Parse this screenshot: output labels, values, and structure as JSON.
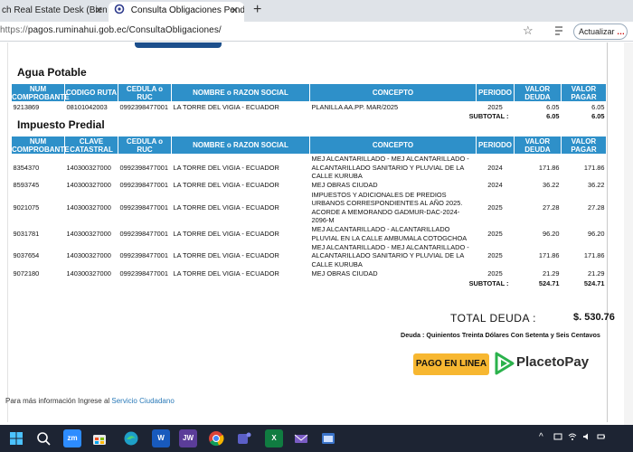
{
  "browser": {
    "tabs": [
      {
        "title": "ch Real Estate Desk (Bienes R"
      },
      {
        "title": "Consulta Obligaciones Pendiente"
      }
    ],
    "url_protocol": "https://",
    "url_rest": "pagos.ruminahui.gob.ec/ConsultaObligaciones/",
    "update_label": "Actualizar"
  },
  "agua": {
    "title": "Agua Potable",
    "headers": [
      "NUM COMPROBANTE",
      "CODIGO RUTA",
      "CEDULA o RUC",
      "NOMBRE o RAZON SOCIAL",
      "CONCEPTO",
      "PERIODO",
      "VALOR DEUDA",
      "VALOR PAGAR"
    ],
    "rows": [
      {
        "comprobante": "9213869",
        "codigo": "08101042003",
        "cedula": "0992398477001",
        "nombre": "LA TORRE DEL VIGIA - ECUADOR",
        "concepto": "PLANILLA AA.PP. MAR/2025",
        "periodo": "2025",
        "deuda": "6.05",
        "pagar": "6.05"
      }
    ],
    "subtotal_label": "SUBTOTAL :",
    "subtotal_deuda": "6.05",
    "subtotal_pagar": "6.05"
  },
  "predial": {
    "title": "Impuesto Predial",
    "headers": [
      "NUM COMPROBANTE",
      "CLAVE CATASTRAL",
      "CEDULA o RUC",
      "NOMBRE o RAZON SOCIAL",
      "CONCEPTO",
      "PERIODO",
      "VALOR DEUDA",
      "VALOR PAGAR"
    ],
    "rows": [
      {
        "comprobante": "8354370",
        "clave": "140300327000",
        "cedula": "0992398477001",
        "nombre": "LA TORRE DEL VIGIA - ECUADOR",
        "concepto": "MEJ ALCANTARILLADO - MEJ ALCANTARILLADO - ALCANTARILLADO SANITARIO Y PLUVIAL DE LA CALLE KURUBA",
        "periodo": "2024",
        "deuda": "171.86",
        "pagar": "171.86"
      },
      {
        "comprobante": "8593745",
        "clave": "140300327000",
        "cedula": "0992398477001",
        "nombre": "LA TORRE DEL VIGIA - ECUADOR",
        "concepto": "MEJ OBRAS CIUDAD",
        "periodo": "2024",
        "deuda": "36.22",
        "pagar": "36.22"
      },
      {
        "comprobante": "9021075",
        "clave": "140300327000",
        "cedula": "0992398477001",
        "nombre": "LA TORRE DEL VIGIA - ECUADOR",
        "concepto": "IMPUESTOS Y ADICIONALES DE PREDIOS URBANOS CORRESPONDIENTES AL AÑO 2025. ACORDE A MEMORANDO GADMUR-DAC-2024-2096-M",
        "periodo": "2025",
        "deuda": "27.28",
        "pagar": "27.28"
      },
      {
        "comprobante": "9031781",
        "clave": "140300327000",
        "cedula": "0992398477001",
        "nombre": "LA TORRE DEL VIGIA - ECUADOR",
        "concepto": "MEJ ALCANTARILLADO - ALCANTARILLADO PLUVIAL EN LA CALLE AMBUMALA COTOGCHOA",
        "periodo": "2025",
        "deuda": "96.20",
        "pagar": "96.20"
      },
      {
        "comprobante": "9037654",
        "clave": "140300327000",
        "cedula": "0992398477001",
        "nombre": "LA TORRE DEL VIGIA - ECUADOR",
        "concepto": "MEJ ALCANTARILLADO - MEJ ALCANTARILLADO - ALCANTARILLADO SANITARIO Y PLUVIAL DE LA CALLE KURUBA",
        "periodo": "2025",
        "deuda": "171.86",
        "pagar": "171.86"
      },
      {
        "comprobante": "9072180",
        "clave": "140300327000",
        "cedula": "0992398477001",
        "nombre": "LA TORRE DEL VIGIA - ECUADOR",
        "concepto": "MEJ OBRAS CIUDAD",
        "periodo": "2025",
        "deuda": "21.29",
        "pagar": "21.29"
      }
    ],
    "subtotal_label": "SUBTOTAL :",
    "subtotal_deuda": "524.71",
    "subtotal_pagar": "524.71"
  },
  "summary": {
    "total_label": "TOTAL DEUDA :",
    "total_value": "$. 530.76",
    "deuda_text": "Deuda : Quinientos Treinta Dólares Con Setenta y Seis Centavos"
  },
  "payment": {
    "pay_button": "PAGO EN LINEA",
    "placetopay_label": "PlacetoPay"
  },
  "footer": {
    "info_text": "Para más información Ingrese al ",
    "link_text": "Servicio Ciudadano"
  },
  "taskbar": {
    "zoom_label": "zm",
    "word_label": "W",
    "jw_label": "JW",
    "excel_label": "X"
  },
  "colors": {
    "table_header": "#2e90c9",
    "pay_button": "#f7b731",
    "link": "#2a7ab8",
    "taskbar": "#1d2433"
  }
}
